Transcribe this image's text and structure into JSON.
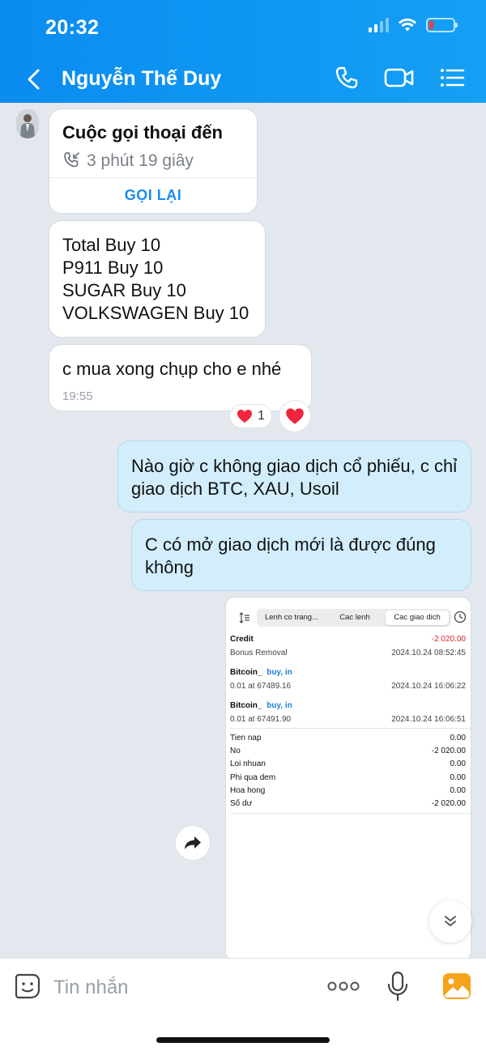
{
  "status": {
    "time": "20:32"
  },
  "header": {
    "contact_name": "Nguyễn Thế Duy"
  },
  "messages": {
    "call": {
      "title": "Cuộc gọi thoại đến",
      "duration": "3 phút 19 giây",
      "callback": "GỌI LẠI"
    },
    "orders": {
      "lines": [
        "Total Buy 10",
        "P911 Buy 10",
        "SUGAR Buy 10",
        "VOLKSWAGEN Buy 10"
      ]
    },
    "request": {
      "text": "c mua xong chụp cho e nhé",
      "time": "19:55",
      "reaction_count": "1"
    },
    "out1": {
      "text": "Nào giờ c không giao dịch cổ phiếu, c chỉ giao dịch BTC, XAU, Usoil"
    },
    "out2": {
      "text": "C có mở giao dịch mới là được đúng không"
    }
  },
  "screenshot": {
    "tabs": [
      "Lenh co trang...",
      "Cac lenh",
      "Cac giao dich"
    ],
    "active_tab": "Cac giao dich",
    "credit": {
      "label": "Credit",
      "sub": "Bonus Removal",
      "amount": "-2 020.00",
      "date": "2024.10.24 08:52:45"
    },
    "trades": [
      {
        "symbol": "Bitcoin_",
        "side": "buy, in",
        "detail": "0.01 at 67489.16",
        "date": "2024.10.24 16:06:22"
      },
      {
        "symbol": "Bitcoin_",
        "side": "buy, in",
        "detail": "0.01 at 67491.90",
        "date": "2024.10.24 16:06:51"
      }
    ],
    "summary": [
      {
        "label": "Tien nap",
        "value": "0.00"
      },
      {
        "label": "No",
        "value": "-2 020.00"
      },
      {
        "label": "Loi nhuan",
        "value": "0.00"
      },
      {
        "label": "Phi qua dem",
        "value": "0.00"
      },
      {
        "label": "Hoa hong",
        "value": "0.00"
      },
      {
        "label": "Số dư",
        "value": "-2 020.00"
      }
    ]
  },
  "composer": {
    "placeholder": "Tin nhắn"
  },
  "colors": {
    "header": "#0a8cf0",
    "bubble_out": "#d2eefd",
    "accent": "#1a8cf0",
    "negative": "#e0202a"
  }
}
